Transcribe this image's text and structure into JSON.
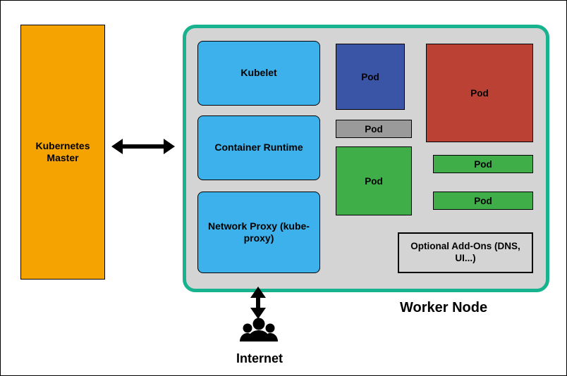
{
  "master": {
    "label": "Kubernetes Master"
  },
  "worker": {
    "label": "Worker Node",
    "services": {
      "kubelet": "Kubelet",
      "runtime": "Container Runtime",
      "proxy": "Network Proxy (kube-proxy)"
    },
    "pods": {
      "blue": "Pod",
      "red": "Pod",
      "gray": "Pod",
      "green1": "Pod",
      "green2": "Pod",
      "green3": "Pod"
    },
    "addons": "Optional Add-Ons (DNS, UI...)"
  },
  "internet": {
    "label": "Internet"
  },
  "colors": {
    "master": "#f4a300",
    "worker_border": "#17b38f",
    "worker_bg": "#d4d4d4",
    "service": "#3cb1eb",
    "pod_blue": "#3b55a6",
    "pod_red": "#bc4135",
    "pod_gray": "#9a9a9a",
    "pod_green": "#3fae49"
  }
}
